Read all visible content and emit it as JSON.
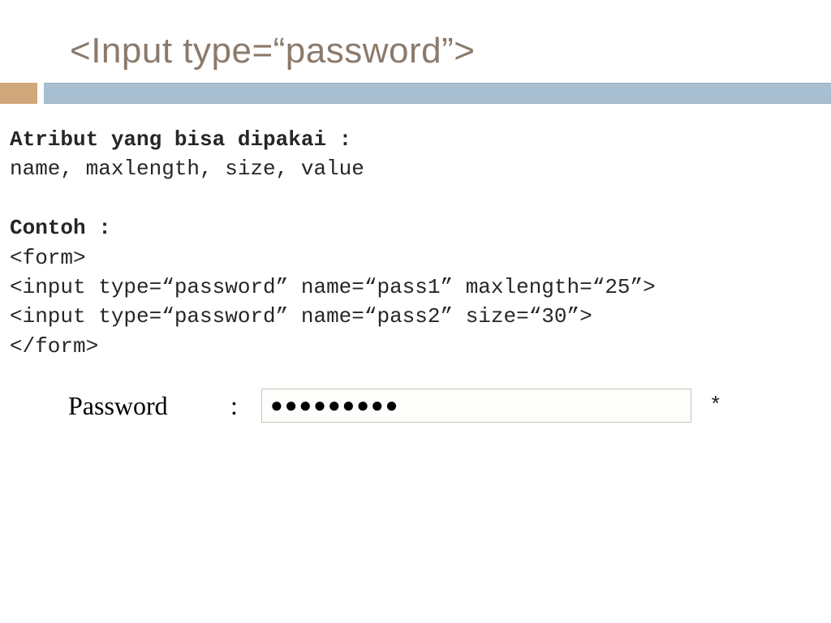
{
  "title": "<Input type=“password”>",
  "body": {
    "attr_heading": "Atribut yang bisa dipakai :",
    "attr_list": "name, maxlength, size, value",
    "example_heading": "Contoh :",
    "code": {
      "l1": "<form>",
      "l2": " <input type=“password” name=“pass1” maxlength=“25”>",
      "l3": " <input type=“password” name=“pass2” size=“30”>",
      "l4": "</form>"
    }
  },
  "demo": {
    "label": "Password",
    "colon": ":",
    "masked_value": "●●●●●●●●●",
    "required_mark": "*"
  },
  "colors": {
    "title_text": "#8b7a6b",
    "accent_brown": "#cfa77a",
    "accent_blue": "#a7bfd0"
  }
}
